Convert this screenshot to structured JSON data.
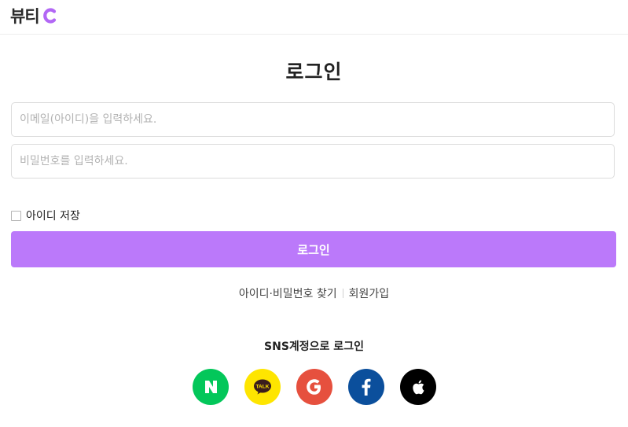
{
  "header": {
    "logo_text": "뷰티"
  },
  "login": {
    "title": "로그인",
    "email_placeholder": "이메일(아이디)을 입력하세요.",
    "email_value": "",
    "password_placeholder": "비밀번호를 입력하세요.",
    "password_value": "",
    "remember_label": "아이디 저장",
    "remember_checked": false,
    "submit_label": "로그인"
  },
  "links": {
    "find_label": "아이디·비밀번호 찾기",
    "signup_label": "회원가입"
  },
  "sns": {
    "title": "SNS계정으로 로그인",
    "buttons": [
      {
        "provider": "naver",
        "icon": "naver-icon",
        "color": "#03c75a"
      },
      {
        "provider": "kakao",
        "icon": "kakao-talk-icon",
        "color": "#fee500",
        "icon_text": "TALK"
      },
      {
        "provider": "google",
        "icon": "google-icon",
        "color": "#e6503e"
      },
      {
        "provider": "facebook",
        "icon": "facebook-icon",
        "color": "#0b4f9c"
      },
      {
        "provider": "apple",
        "icon": "apple-icon",
        "color": "#000000"
      }
    ]
  },
  "colors": {
    "accent": "#bb79fa",
    "logo_accent": "#b267f5"
  }
}
